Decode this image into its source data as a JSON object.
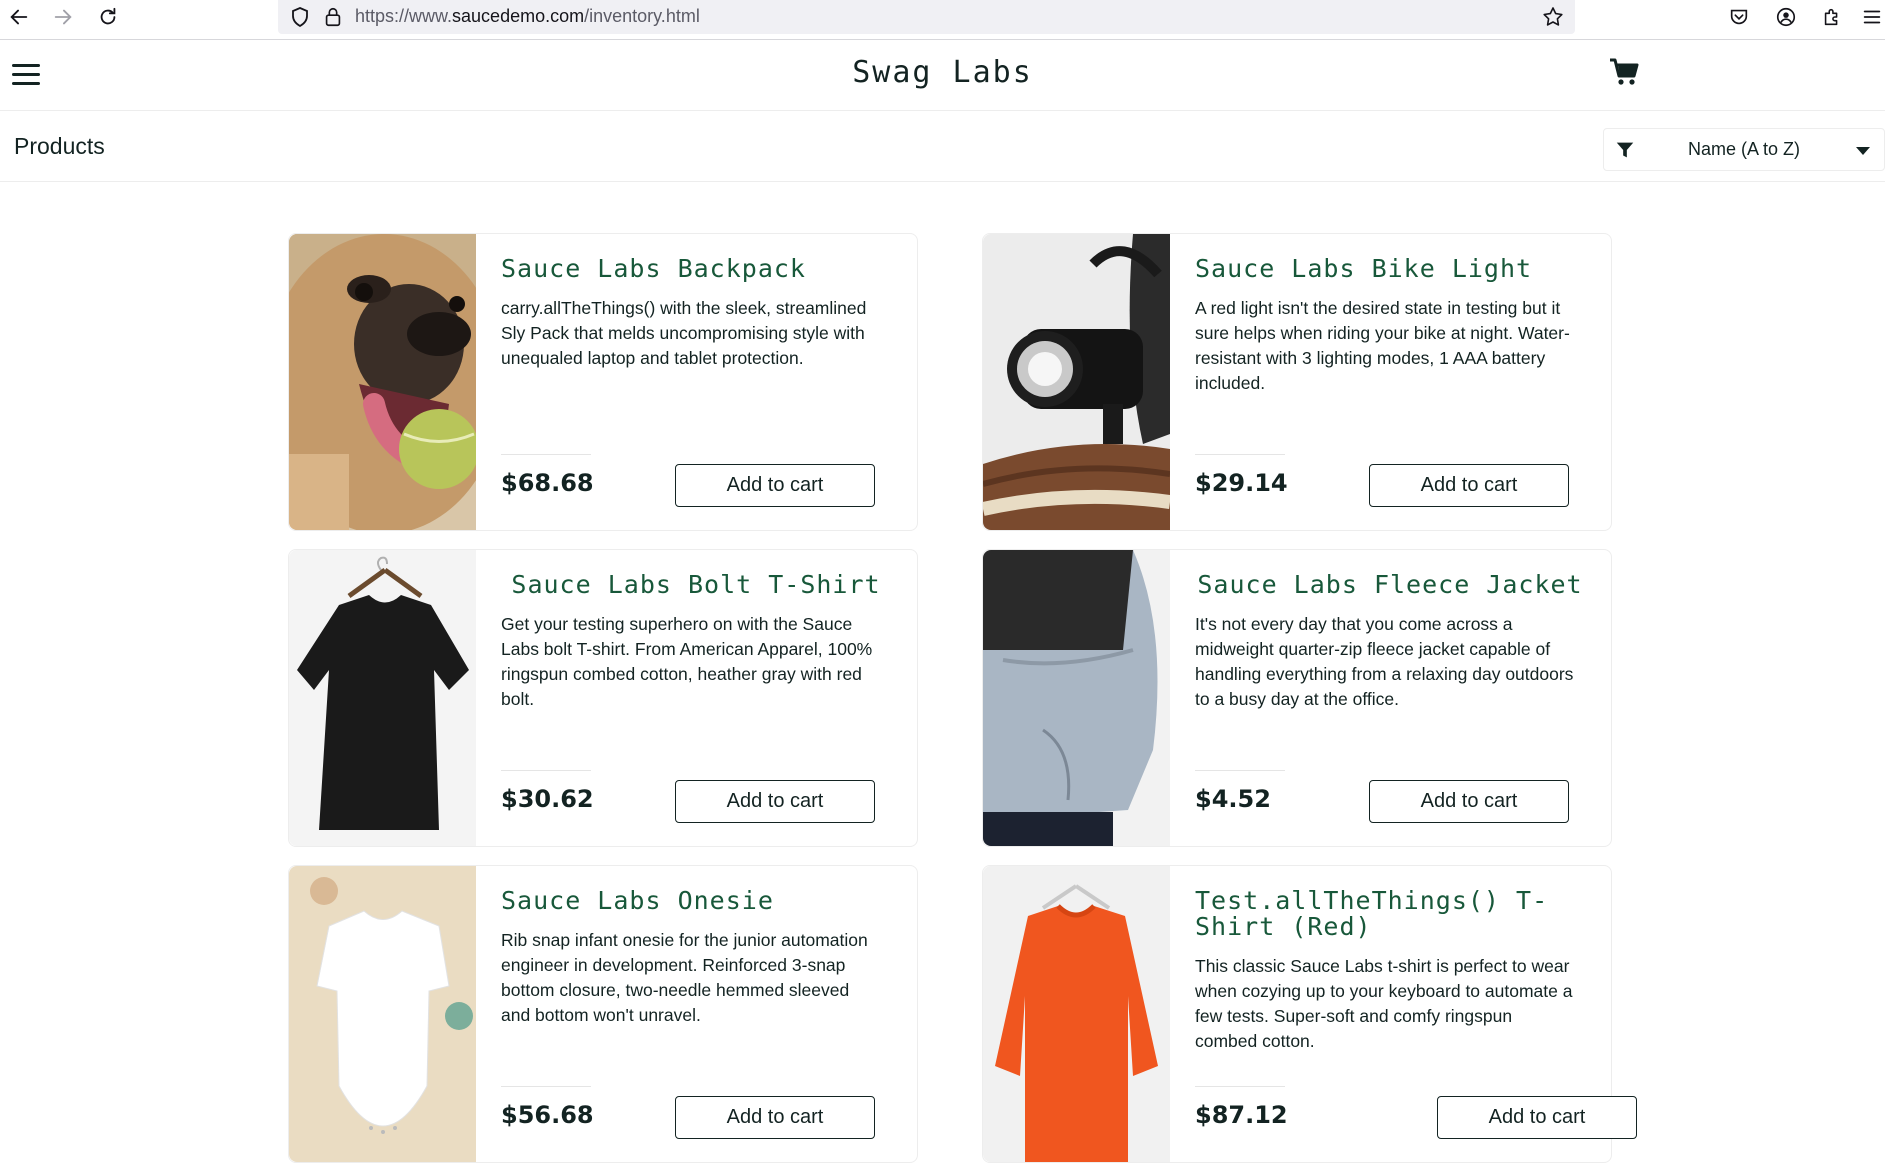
{
  "browser": {
    "url_prefix": "https://www.",
    "url_host": "saucedemo.com",
    "url_path": "/inventory.html"
  },
  "app": {
    "logo": "Swag Labs",
    "page_title": "Products",
    "sort": {
      "selected": "Name (A to Z)"
    }
  },
  "products": [
    {
      "name": "Sauce Labs Backpack",
      "description": "carry.allTheThings() with the sleek, streamlined Sly Pack that melds uncompromising style with unequaled laptop and tablet protection.",
      "price": "$68.68",
      "button": "Add to cart",
      "image": "pug-with-tennis-ball"
    },
    {
      "name": "Sauce Labs Bike Light",
      "description": "A red light isn't the desired state in testing but it sure helps when riding your bike at night. Water-resistant with 3 lighting modes, 1 AAA battery included.",
      "price": "$29.14",
      "button": "Add to cart",
      "image": "bike-light"
    },
    {
      "name": "Sauce Labs Bolt T-Shirt",
      "description": "Get your testing superhero on with the Sauce Labs bolt T-shirt. From American Apparel, 100% ringspun combed cotton, heather gray with red bolt.",
      "price": "$30.62",
      "button": "Add to cart",
      "image": "black-tshirt"
    },
    {
      "name": "Sauce Labs Fleece Jacket",
      "description": "It's not every day that you come across a midweight quarter-zip fleece jacket capable of handling everything from a relaxing day outdoors to a busy day at the office.",
      "price": "$4.52",
      "button": "Add to cart",
      "image": "fleece-jacket"
    },
    {
      "name": "Sauce Labs Onesie",
      "description": "Rib snap infant onesie for the junior automation engineer in development. Reinforced 3-snap bottom closure, two-needle hemmed sleeved and bottom won't unravel.",
      "price": "$56.68",
      "button": "Add to cart",
      "image": "white-onesie"
    },
    {
      "name": "Test.allTheThings() T-Shirt (Red)",
      "description": "This classic Sauce Labs t-shirt is perfect to wear when cozying up to your keyboard to automate a few tests. Super-soft and comfy ringspun combed cotton.",
      "price": "$87.12",
      "button": "Add to cart",
      "image": "red-sweatshirt"
    }
  ],
  "colors": {
    "product_name": "#18583a",
    "text": "#132322",
    "border": "#ededed"
  }
}
